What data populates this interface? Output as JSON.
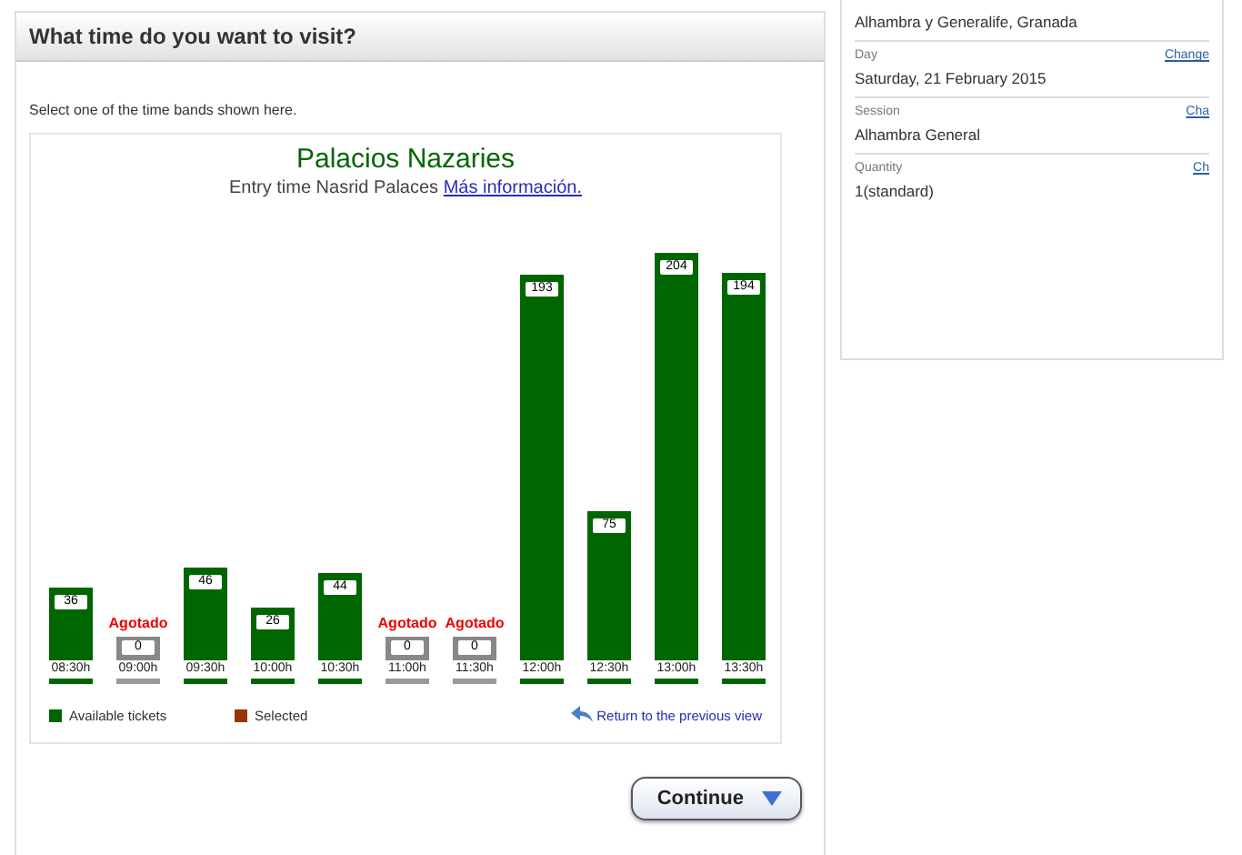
{
  "main": {
    "heading": "What time do you want to visit?",
    "instruction": "Select one of the time bands shown here.",
    "chart": {
      "title": "Palacios Nazaries",
      "subtitle": "Entry time Nasrid Palaces",
      "info_link": "Más información.",
      "chart_data": {
        "type": "bar",
        "categories": [
          "08:30h",
          "09:00h",
          "09:30h",
          "10:00h",
          "10:30h",
          "11:00h",
          "11:30h",
          "12:00h",
          "12:30h",
          "13:00h",
          "13:30h"
        ],
        "series": [
          {
            "name": "Available tickets",
            "color": "#006600",
            "values": [
              36,
              0,
              46,
              26,
              44,
              0,
              0,
              193,
              75,
              204,
              194
            ]
          }
        ],
        "data_labels": true,
        "annotations": [
          null,
          "Agotado",
          null,
          null,
          null,
          "Agotado",
          "Agotado",
          null,
          null,
          null,
          null
        ]
      },
      "legend": [
        {
          "label": "Selected",
          "color": "#993300"
        }
      ],
      "return_link": "Return to the previous view"
    },
    "continue_button": "Continue"
  },
  "summary": [
    {
      "value": "Alhambra y Generalife, Granada"
    },
    {
      "label": "Day",
      "value": "Saturday, 21 February 2015",
      "link": "Change"
    },
    {
      "label": "Session",
      "value": "Alhambra General",
      "link": "Cha"
    },
    {
      "label": "Quantity",
      "value": "1(standard)",
      "link": "Ch"
    }
  ]
}
